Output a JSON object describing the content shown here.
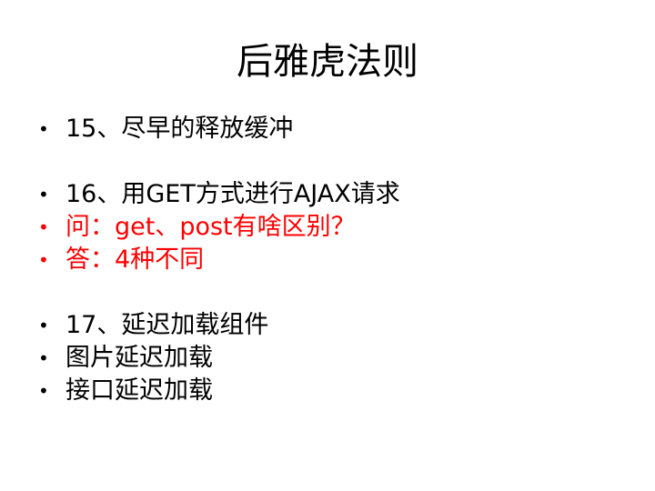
{
  "slide": {
    "title": "后雅虎法则",
    "bullet_symbol": "•",
    "items": [
      {
        "text": "15、尽早的释放缓冲",
        "color": "#000000"
      },
      {
        "text": "16、用GET方式进行AJAX请求",
        "color": "#000000"
      },
      {
        "text": "问：get、post有啥区别？",
        "color": "#ff0000"
      },
      {
        "text": "答：4种不同",
        "color": "#ff0000"
      },
      {
        "text": "17、延迟加载组件",
        "color": "#000000"
      },
      {
        "text": "图片延迟加载",
        "color": "#000000"
      },
      {
        "text": "接口延迟加载",
        "color": "#000000"
      }
    ]
  }
}
